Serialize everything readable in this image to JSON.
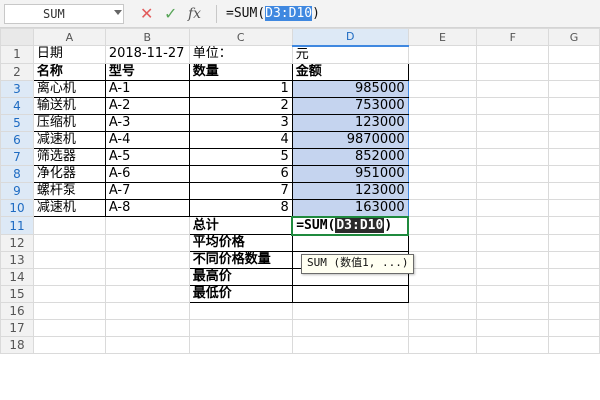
{
  "formula_bar": {
    "name_box": "SUM",
    "cancel_glyph": "✕",
    "enter_glyph": "✓",
    "fx_label": "fx",
    "formula_prefix": "=SUM(",
    "formula_ref": "D3:D10",
    "formula_suffix": ")"
  },
  "columns": [
    "A",
    "B",
    "C",
    "D",
    "E",
    "F",
    "G"
  ],
  "row_numbers": [
    "1",
    "2",
    "3",
    "4",
    "5",
    "6",
    "7",
    "8",
    "9",
    "10",
    "11",
    "12",
    "13",
    "14",
    "15",
    "16",
    "17",
    "18"
  ],
  "cells": {
    "r1": {
      "a": "日期",
      "b": "2018-11-27",
      "c": "单位：",
      "d": "元"
    },
    "r2": {
      "a": "名称",
      "b": "型号",
      "c": "数量",
      "d": "金额"
    },
    "rows": [
      {
        "a": "离心机",
        "b": "A-1",
        "c": "1",
        "d": "985000"
      },
      {
        "a": "输送机",
        "b": "A-2",
        "c": "2",
        "d": "753000"
      },
      {
        "a": "压缩机",
        "b": "A-3",
        "c": "3",
        "d": "123000"
      },
      {
        "a": "减速机",
        "b": "A-4",
        "c": "4",
        "d": "9870000"
      },
      {
        "a": "筛选器",
        "b": "A-5",
        "c": "5",
        "d": "852000"
      },
      {
        "a": "净化器",
        "b": "A-6",
        "c": "6",
        "d": "951000"
      },
      {
        "a": "螺杆泵",
        "b": "A-7",
        "c": "7",
        "d": "123000"
      },
      {
        "a": "减速机",
        "b": "A-8",
        "c": "8",
        "d": "163000"
      }
    ],
    "r11": {
      "c": "总计",
      "d_prefix": "=SUM(",
      "d_ref": "D3:D10",
      "d_suffix": ")"
    },
    "r12": {
      "c": "平均价格"
    },
    "r13": {
      "c": "不同价格数量"
    },
    "r14": {
      "c": "最高价"
    },
    "r15": {
      "c": "最低价"
    }
  },
  "tooltip": "SUM (数值1, ...)"
}
